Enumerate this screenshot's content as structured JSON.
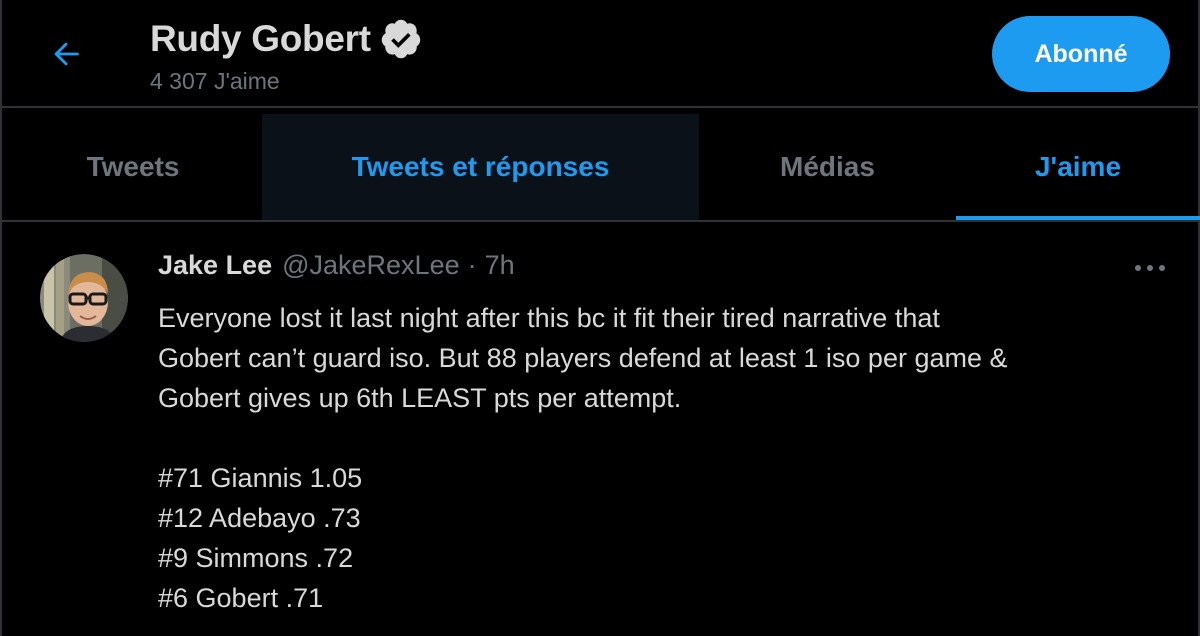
{
  "header": {
    "back_icon": "arrow-left-icon",
    "name": "Rudy Gobert",
    "verified_icon": "verified-badge-icon",
    "subtitle": "4 307 J'aime",
    "follow_label": "Abonné"
  },
  "tabs": [
    {
      "label": "Tweets",
      "state": "inactive"
    },
    {
      "label": "Tweets et réponses",
      "state": "hovered"
    },
    {
      "label": "Médias",
      "state": "inactive"
    },
    {
      "label": "J'aime",
      "state": "active"
    }
  ],
  "tweet": {
    "author_name": "Jake Lee",
    "author_handle": "@JakeRexLee",
    "separator": "·",
    "time": "7h",
    "more_icon": "more-horizontal-icon",
    "text_paragraph": "Everyone lost it last night after this bc it fit their tired narrative that Gobert can’t guard iso. But 88 players defend at least 1 iso per game & Gobert gives up 6th LEAST pts per attempt.",
    "text_lines": [
      "Everyone lost it last night after this bc it fit their tired narrative that",
      "Gobert can’t guard iso. But 88 players defend at least 1 iso per game &",
      "Gobert gives up 6th LEAST pts per attempt."
    ],
    "rankings": [
      "#71 Giannis 1.05",
      "#12 Adebayo .73",
      "#9 Simmons .72",
      "#6 Gobert .71"
    ]
  },
  "colors": {
    "background": "#000000",
    "accent": "#1d9bf0",
    "text_primary": "#d9d9d9",
    "text_secondary": "#6e767d",
    "border": "#2f3336"
  }
}
